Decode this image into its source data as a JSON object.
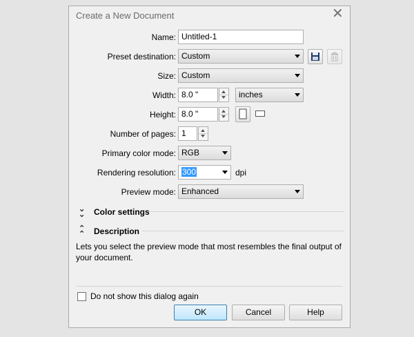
{
  "dialog": {
    "title": "Create a New Document",
    "close_glyph": "✕"
  },
  "fields": {
    "name_label": "Name:",
    "name_value": "Untitled-1",
    "preset_label": "Preset destination:",
    "preset_value": "Custom",
    "size_label": "Size:",
    "size_value": "Custom",
    "width_label": "Width:",
    "width_value": "8.0 \"",
    "units_value": "inches",
    "height_label": "Height:",
    "height_value": "8.0 \"",
    "pages_label": "Number of pages:",
    "pages_value": "1",
    "color_mode_label": "Primary color mode:",
    "color_mode_value": "RGB",
    "resolution_label": "Rendering resolution:",
    "resolution_value": "300",
    "resolution_unit": "dpi",
    "preview_label": "Preview mode:",
    "preview_value": "Enhanced"
  },
  "sections": {
    "color_settings": "Color settings",
    "description": "Description",
    "description_text": "Lets you select the preview mode that most resembles the final output of your document."
  },
  "footer": {
    "dont_show_label": "Do not show this dialog again",
    "dont_show_checked": false,
    "ok_label": "OK",
    "cancel_label": "Cancel",
    "help_label": "Help"
  },
  "icons": {
    "save_preset": "save-icon",
    "delete_preset": "trash-icon",
    "portrait": "portrait-orientation-icon",
    "landscape": "landscape-orientation-icon"
  }
}
